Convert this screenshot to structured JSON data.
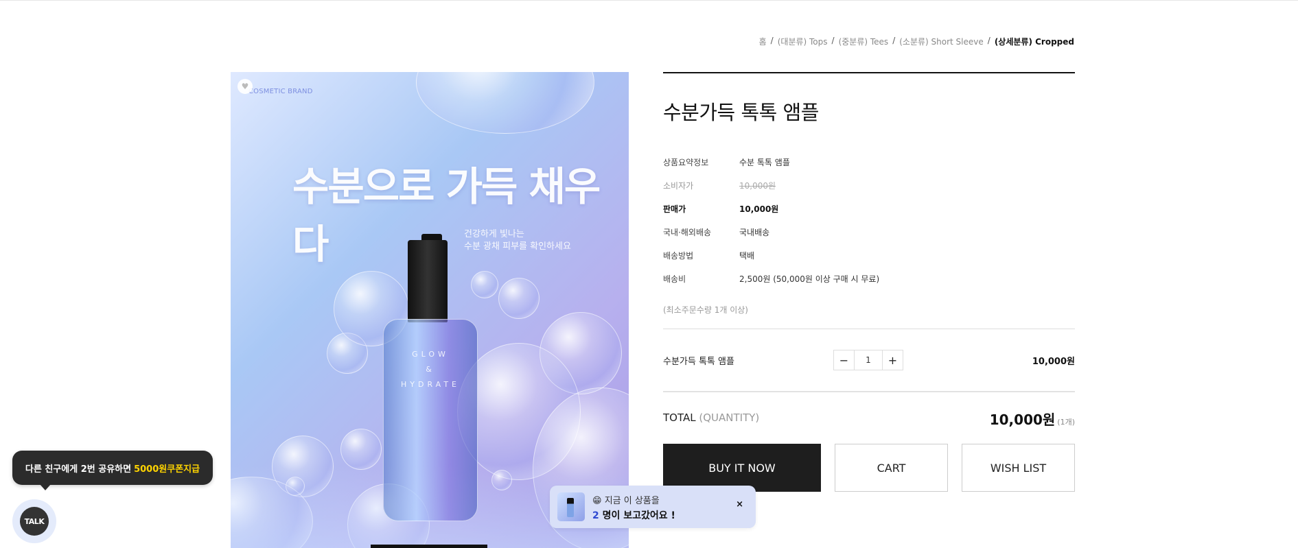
{
  "breadcrumb": {
    "items": [
      "홈",
      "(대분류) Tops",
      "(중분류) Tees",
      "(소분류) Short Sleeve"
    ],
    "current": "(상세분류) Cropped"
  },
  "image": {
    "brand": "COSMETIC BRAND",
    "hero_title": "수분으로 가득 채우다",
    "hero_sub_1": "건강하게 빛나는",
    "hero_sub_2": "수분 광채 피부를 확인하세요",
    "bottle_label_1": "GLOW",
    "bottle_label_2": "&",
    "bottle_label_3": "HYDRATE"
  },
  "product": {
    "title": "수분가득 톡톡 앰플",
    "specs": [
      {
        "label": "상품요약정보",
        "value": "수분 톡톡 앰플"
      },
      {
        "label": "소비자가",
        "value": "10,000원"
      },
      {
        "label": "판매가",
        "value": "10,000원"
      },
      {
        "label": "국내·해외배송",
        "value": "국내배송"
      },
      {
        "label": "배송방법",
        "value": "택배"
      },
      {
        "label": "배송비",
        "value": "2,500원 (50,000원 이상 구매 시 무료)"
      }
    ],
    "min_qty": "(최소주문수량 1개 이상)"
  },
  "option": {
    "name": "수분가득 톡톡 앰플",
    "minus": "−",
    "quantity": "1",
    "plus": "+",
    "price": "10,000원"
  },
  "total": {
    "label": "TOTAL",
    "label_sub": "(QUANTITY)",
    "amount": "10,000원",
    "count": "(1개)"
  },
  "actions": {
    "buy": "BUY IT NOW",
    "cart": "CART",
    "wish": "WISH LIST"
  },
  "viewers": {
    "emoji": "😁",
    "line1": "지금 이 상품을",
    "count": "2",
    "line2": "명이 보고갔어요 !",
    "close": "×"
  },
  "share": {
    "text": "다른 친구에게 2번 공유하면",
    "highlight": "5000원쿠폰지급"
  },
  "talk": {
    "label": "TALK"
  }
}
